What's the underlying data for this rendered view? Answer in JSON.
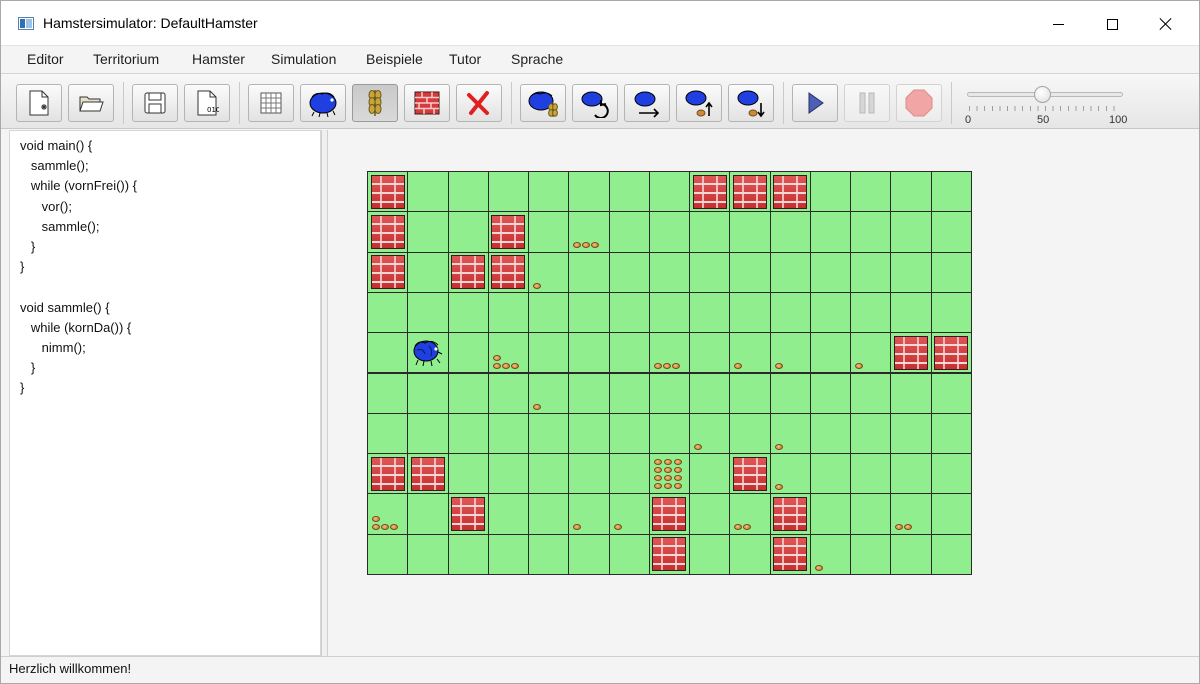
{
  "window": {
    "title": "Hamstersimulator: DefaultHamster"
  },
  "menu": {
    "items": [
      "Editor",
      "Territorium",
      "Hamster",
      "Simulation",
      "Beispiele",
      "Tutor",
      "Sprache"
    ]
  },
  "toolbar": {
    "buttons": [
      {
        "icon": "new-file-icon"
      },
      {
        "icon": "open-folder-icon"
      },
      {
        "icon": "save-icon"
      },
      {
        "icon": "compile-icon"
      },
      {
        "icon": "grid-size-icon"
      },
      {
        "icon": "place-hamster-icon"
      },
      {
        "icon": "place-grain-icon",
        "state": "pressed"
      },
      {
        "icon": "place-wall-icon"
      },
      {
        "icon": "delete-icon"
      },
      {
        "icon": "hamster-grain-icon"
      },
      {
        "icon": "turn-left-icon"
      },
      {
        "icon": "move-forward-icon"
      },
      {
        "icon": "pick-grain-icon"
      },
      {
        "icon": "put-grain-icon"
      },
      {
        "icon": "play-icon"
      },
      {
        "icon": "pause-icon",
        "state": "disabled"
      },
      {
        "icon": "stop-icon",
        "state": "disabled"
      }
    ],
    "speed_slider": {
      "min_label": "0",
      "mid_label": "50",
      "max_label": "100",
      "value": 50
    }
  },
  "editor": {
    "code_lines": [
      "void main() {",
      "   sammle();",
      "   while (vornFrei()) {",
      "      vor();",
      "      sammle();",
      "   }",
      "}",
      "",
      "void sammle() {",
      "   while (kornDa()) {",
      "      nimm();",
      "   }",
      "}"
    ]
  },
  "territory": {
    "cols": 15,
    "rows": 10,
    "hamster": {
      "row": 4,
      "col": 1,
      "direction": "east"
    },
    "walls": [
      [
        0,
        0
      ],
      [
        0,
        8
      ],
      [
        0,
        9
      ],
      [
        0,
        10
      ],
      [
        1,
        0
      ],
      [
        1,
        3
      ],
      [
        2,
        0
      ],
      [
        2,
        2
      ],
      [
        2,
        3
      ],
      [
        4,
        13
      ],
      [
        4,
        14
      ],
      [
        7,
        0
      ],
      [
        7,
        1
      ],
      [
        7,
        9
      ],
      [
        8,
        2
      ],
      [
        8,
        7
      ],
      [
        8,
        10
      ],
      [
        9,
        7
      ],
      [
        9,
        10
      ]
    ],
    "grains": [
      {
        "row": 1,
        "col": 5,
        "count": 3
      },
      {
        "row": 2,
        "col": 4,
        "count": 1
      },
      {
        "row": 4,
        "col": 3,
        "count": 4
      },
      {
        "row": 4,
        "col": 7,
        "count": 3
      },
      {
        "row": 4,
        "col": 9,
        "count": 1
      },
      {
        "row": 4,
        "col": 10,
        "count": 1
      },
      {
        "row": 4,
        "col": 12,
        "count": 1
      },
      {
        "row": 5,
        "col": 4,
        "count": 1
      },
      {
        "row": 6,
        "col": 8,
        "count": 1
      },
      {
        "row": 6,
        "col": 10,
        "count": 1
      },
      {
        "row": 7,
        "col": 7,
        "count": 12
      },
      {
        "row": 7,
        "col": 10,
        "count": 1
      },
      {
        "row": 8,
        "col": 0,
        "count": 4
      },
      {
        "row": 8,
        "col": 5,
        "count": 1
      },
      {
        "row": 8,
        "col": 6,
        "count": 1
      },
      {
        "row": 8,
        "col": 9,
        "count": 2
      },
      {
        "row": 8,
        "col": 13,
        "count": 2
      },
      {
        "row": 9,
        "col": 11,
        "count": 1
      }
    ]
  },
  "status": {
    "text": "Herzlich willkommen!"
  },
  "colors": {
    "field": "#90ee8f",
    "wall": "#d63b3b",
    "hamster": "#1f3fe0",
    "grain": "#c98a3c"
  }
}
